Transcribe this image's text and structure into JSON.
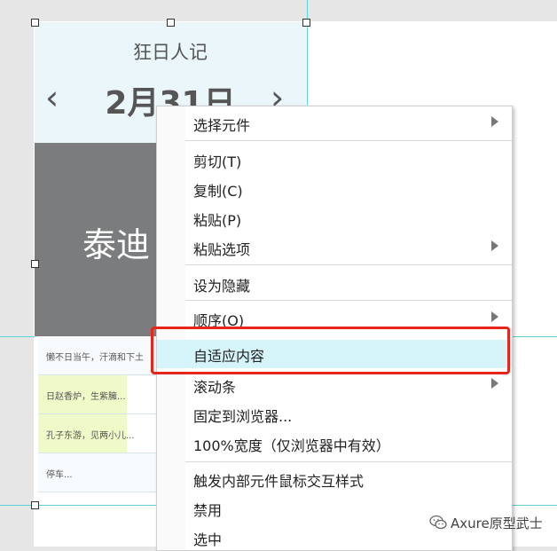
{
  "widget": {
    "title": "狂日人记",
    "date": "2月31日",
    "prev_arrow": "‹",
    "next_arrow": "›",
    "name": "泰迪",
    "rows": [
      "懒不日当午，汗滴和下土",
      "日赵香炉，生紫臃...",
      "孔子东游，见两小儿...",
      "停车..."
    ]
  },
  "context_menu": {
    "items": [
      {
        "label": "选择元件",
        "submenu": true
      },
      {
        "label": "剪切(T)",
        "submenu": false
      },
      {
        "label": "复制(C)",
        "submenu": false
      },
      {
        "label": "粘贴(P)",
        "submenu": false
      },
      {
        "label": "粘贴选项",
        "submenu": true
      },
      {
        "label": "设为隐藏",
        "submenu": false
      },
      {
        "label": "顺序(O)",
        "submenu": true
      },
      {
        "label": "自适应内容",
        "submenu": false,
        "highlighted": true
      },
      {
        "label": "滚动条",
        "submenu": true
      },
      {
        "label": "固定到浏览器...",
        "submenu": false
      },
      {
        "label": "100%宽度（仅浏览器中有效）",
        "submenu": false
      },
      {
        "label": "触发内部元件鼠标交互样式",
        "submenu": false
      },
      {
        "label": "禁用",
        "submenu": false
      },
      {
        "label": "选中",
        "submenu": false
      }
    ]
  },
  "watermark": {
    "text": "Axure原型武士",
    "icon": "wechat-icon"
  },
  "colors": {
    "guide": "#5fd3d8",
    "highlight_box": "#e8251a",
    "menu_active": "#d6f5fb",
    "header_bg": "#eaf6fa",
    "gray_panel": "#7a7c7e"
  }
}
